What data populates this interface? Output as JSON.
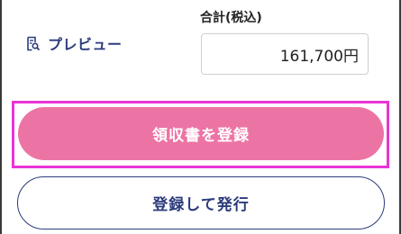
{
  "preview": {
    "label": "プレビュー",
    "icon": "preview-doc-search-icon"
  },
  "total": {
    "label": "合計(税込)",
    "value": "161,700円"
  },
  "buttons": {
    "register_receipt": "領収書を登録",
    "register_and_issue": "登録して発行"
  },
  "colors": {
    "primary_navy": "#2b3b7c",
    "register_pink": "#ec74a5",
    "highlight_magenta": "#ea33d6"
  }
}
